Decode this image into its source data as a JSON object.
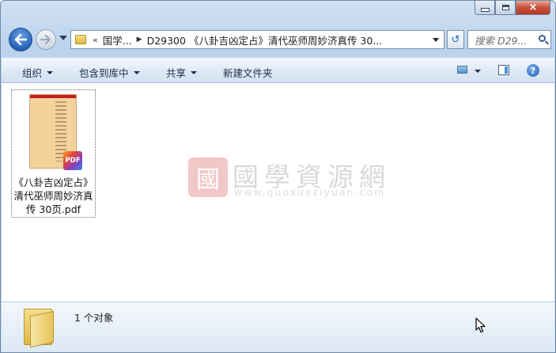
{
  "window": {
    "caption": {
      "minimize": "minimize",
      "maximize": "maximize",
      "close": "×"
    }
  },
  "nav": {
    "breadcrumb": [
      "«",
      "国学...",
      "D29300 《八卦吉凶定占》清代巫师周妙济真传 30..."
    ],
    "search_placeholder": "搜索 D29...",
    "refresh_glyph": "↺"
  },
  "toolbar": {
    "organize": "组织",
    "include_library": "包含到库中",
    "share": "共享",
    "new_folder": "新建文件夹",
    "help": "?"
  },
  "files": [
    {
      "name": "《八卦吉凶定占》清代巫师周妙济真传 30页.pdf",
      "badge": "PDF",
      "thumb_band": "PDF"
    }
  ],
  "watermark": {
    "seal": "國",
    "text": "國學資源網",
    "url": "www.guoxueziyuan.com"
  },
  "details": {
    "count_text": "1 个对象"
  },
  "colors": {
    "accent": "#2460b8",
    "close_red": "#c8503c",
    "pdf_page": "#f3d39c"
  }
}
